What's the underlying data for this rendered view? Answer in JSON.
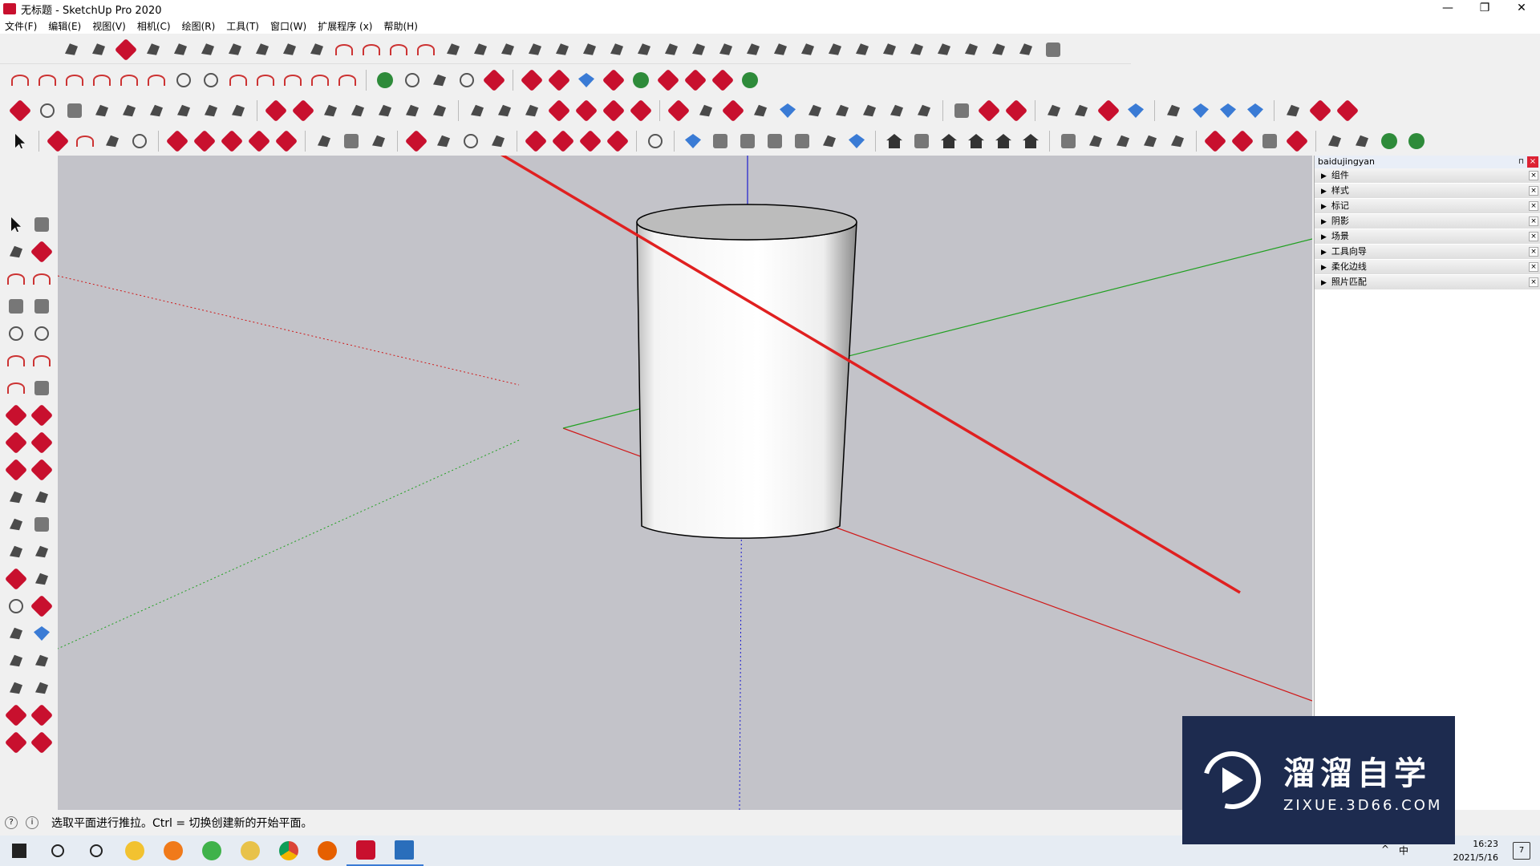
{
  "window": {
    "title": "无标题 - SketchUp Pro 2020",
    "controls": [
      "—",
      "❐",
      "✕"
    ]
  },
  "menu": [
    "文件(F)",
    "编辑(E)",
    "视图(V)",
    "相机(C)",
    "绘图(R)",
    "工具(T)",
    "窗口(W)",
    "扩展程序 (x)",
    "帮助(H)"
  ],
  "tray": {
    "title": "baidujingyan",
    "pin": "⊓",
    "close": "×",
    "panels": [
      "组件",
      "样式",
      "标记",
      "阴影",
      "场景",
      "工具向导",
      "柔化边线",
      "照片匹配"
    ]
  },
  "status": {
    "text": "选取平面进行推拉。Ctrl = 切换创建新的开始平面。",
    "help_icon": "?",
    "info_icon": "i"
  },
  "taskbar": {
    "time": "16:23",
    "date": "2021/5/16",
    "notification": "7",
    "ime": "中",
    "tray_arrow": "^"
  },
  "watermark": {
    "cn": "溜溜自学",
    "en": "ZIXUE.3D66.COM"
  },
  "colors": {
    "viewport": "#c3c3c9",
    "axis_red": "#d01818",
    "axis_green": "#20a020",
    "axis_blue": "#1a1ad0",
    "annotation": "#e02020",
    "watermark_bg": "#1d2b4f"
  }
}
